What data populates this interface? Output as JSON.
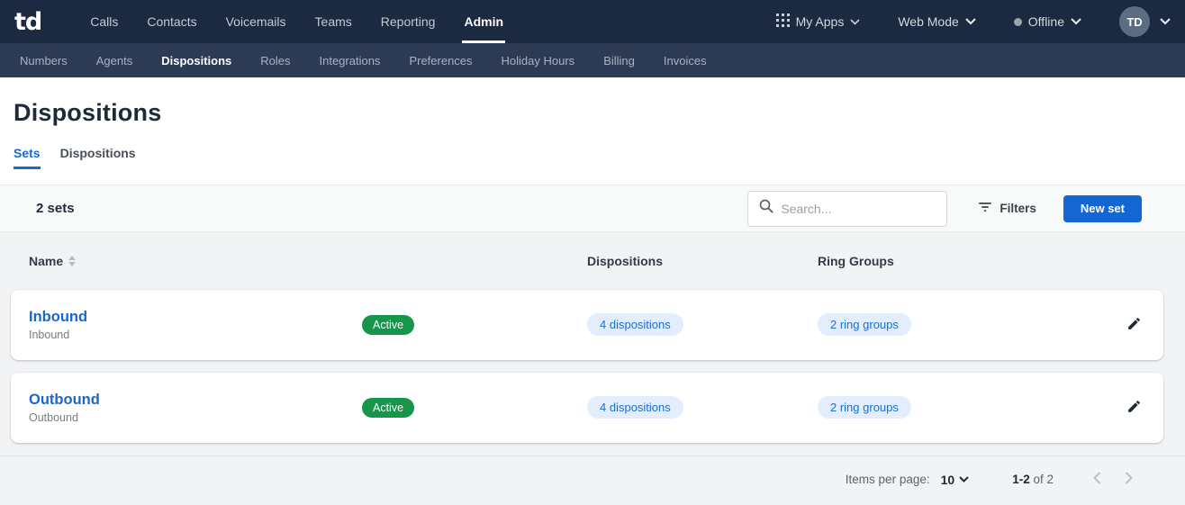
{
  "topbar": {
    "logo": "td",
    "nav": [
      {
        "label": "Calls",
        "active": false
      },
      {
        "label": "Contacts",
        "active": false
      },
      {
        "label": "Voicemails",
        "active": false
      },
      {
        "label": "Teams",
        "active": false
      },
      {
        "label": "Reporting",
        "active": false
      },
      {
        "label": "Admin",
        "active": true
      }
    ],
    "my_apps_label": "My Apps",
    "web_mode_label": "Web Mode",
    "presence_label": "Offline",
    "avatar_initials": "TD"
  },
  "subnav": {
    "items": [
      {
        "label": "Numbers",
        "active": false
      },
      {
        "label": "Agents",
        "active": false
      },
      {
        "label": "Dispositions",
        "active": true
      },
      {
        "label": "Roles",
        "active": false
      },
      {
        "label": "Integrations",
        "active": false
      },
      {
        "label": "Preferences",
        "active": false
      },
      {
        "label": "Holiday Hours",
        "active": false
      },
      {
        "label": "Billing",
        "active": false
      },
      {
        "label": "Invoices",
        "active": false
      }
    ]
  },
  "page": {
    "title": "Dispositions",
    "tabs": [
      {
        "label": "Sets",
        "active": true
      },
      {
        "label": "Dispositions",
        "active": false
      }
    ]
  },
  "toolbar": {
    "count_label": "2 sets",
    "search_placeholder": "Search...",
    "filters_label": "Filters",
    "new_set_label": "New set"
  },
  "table": {
    "headers": {
      "name": "Name",
      "dispositions": "Dispositions",
      "ring_groups": "Ring Groups"
    },
    "rows": [
      {
        "name": "Inbound",
        "subtitle": "Inbound",
        "status": "Active",
        "dispositions_chip": "4 dispositions",
        "ring_groups_chip": "2 ring groups"
      },
      {
        "name": "Outbound",
        "subtitle": "Outbound",
        "status": "Active",
        "dispositions_chip": "4 dispositions",
        "ring_groups_chip": "2 ring groups"
      }
    ]
  },
  "pagination": {
    "items_per_page_label": "Items per page:",
    "items_per_page_value": "10",
    "range": "1-2",
    "total": "of 2"
  },
  "colors": {
    "topbar_bg": "#1b2a40",
    "subnav_bg": "#2c3b53",
    "accent_blue": "#1467d2",
    "link_blue": "#1669d2",
    "badge_green": "#16954b",
    "chip_bg": "#e3edfb",
    "chip_text": "#1a6fd4",
    "content_bg": "#f1f3f5"
  }
}
